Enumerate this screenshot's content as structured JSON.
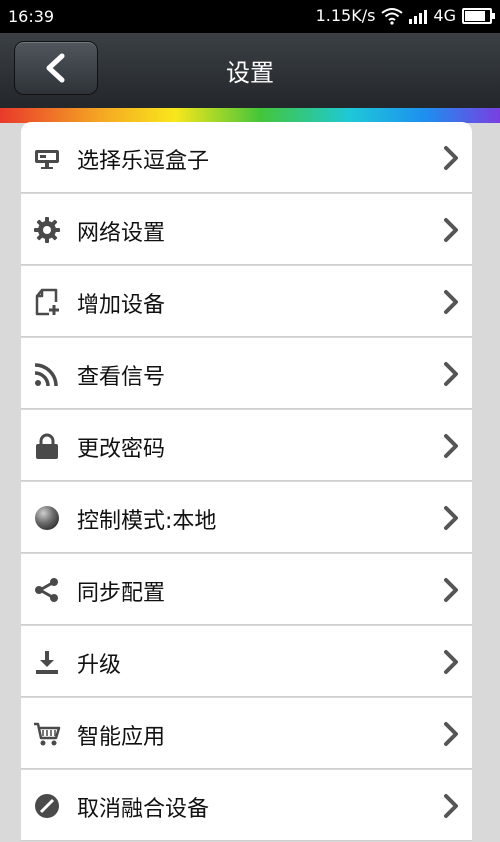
{
  "status": {
    "time": "16:39",
    "speed": "1.15K/s",
    "network": "4G"
  },
  "header": {
    "title": "设置"
  },
  "menu": {
    "items": [
      {
        "label": "选择乐逗盒子",
        "icon": "tv-box-icon"
      },
      {
        "label": "网络设置",
        "icon": "gear-icon"
      },
      {
        "label": "增加设备",
        "icon": "add-device-icon"
      },
      {
        "label": "查看信号",
        "icon": "signal-icon"
      },
      {
        "label": "更改密码",
        "icon": "lock-icon"
      },
      {
        "label": "控制模式:本地",
        "icon": "globe-icon"
      },
      {
        "label": "同步配置",
        "icon": "share-icon"
      },
      {
        "label": "升级",
        "icon": "download-icon"
      },
      {
        "label": "智能应用",
        "icon": "cart-icon"
      },
      {
        "label": "取消融合设备",
        "icon": "cancel-icon"
      }
    ]
  },
  "colors": {
    "header": "#2b2f33",
    "icon": "#4a4a4a",
    "chevron": "#555555"
  }
}
